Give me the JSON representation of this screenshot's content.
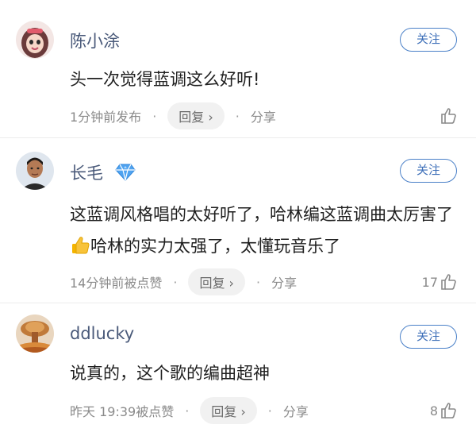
{
  "comments": [
    {
      "name": "陈小涂",
      "follow_label": "关注",
      "text": "头一次觉得蓝调这么好听!",
      "time": "1分钟前发布",
      "reply_label": "回复 ›",
      "share_label": "分享",
      "likes": "",
      "avatar_icon": "cartoon-girl-avatar"
    },
    {
      "name": "长毛",
      "follow_label": "关注",
      "text_part1": "这蓝调风格唱的太好听了，哈林编这蓝调曲太厉害了",
      "text_part2": "哈林的实力太强了，太懂玩音乐了",
      "time": "14分钟前被点赞",
      "reply_label": "回复 ›",
      "share_label": "分享",
      "likes": "17",
      "badge_icon": "blue-diamond-badge-icon",
      "avatar_icon": "man-portrait-avatar"
    },
    {
      "name": "ddlucky",
      "follow_label": "关注",
      "text": "说真的，这个歌的编曲超神",
      "time": "昨天 19:39被点赞",
      "reply_label": "回复 ›",
      "share_label": "分享",
      "likes": "8",
      "avatar_icon": "explosion-avatar"
    }
  ],
  "colors": {
    "accent": "#3d6fb8",
    "name": "#4a5a7a",
    "meta": "#8a8a8a"
  }
}
